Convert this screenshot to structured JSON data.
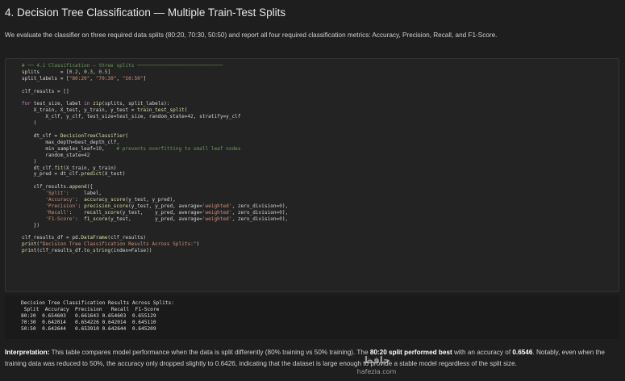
{
  "section": {
    "title": "4. Decision Tree Classification — Multiple Train-Test Splits",
    "intro": "We evaluate the classifier on three required data splits (80:20, 70:30, 50:50) and report all four required classification metrics: Accuracy, Precision, Recall, and F1-Score."
  },
  "code_lines": [
    "# ── 4.1 Classification – three splits ─────────────────────────────",
    "splits       = [0.2, 0.3, 0.5]",
    "split_labels = [\"80:20\", \"70:30\", \"50:50\"]",
    "",
    "clf_results = []",
    "",
    "for test_size, label in zip(splits, split_labels):",
    "    X_train, X_test, y_train, y_test = train_test_split(",
    "        X_clf, y_clf, test_size=test_size, random_state=42, stratify=y_clf",
    "    )",
    "",
    "    dt_clf = DecisionTreeClassifier(",
    "        max_depth=best_depth_clf,",
    "        min_samples_leaf=10,    # prevents overfitting to small leaf nodes",
    "        random_state=42",
    "    )",
    "    dt_clf.fit(X_train, y_train)",
    "    y_pred = dt_clf.predict(X_test)",
    "",
    "    clf_results.append({",
    "        'Split':     label,",
    "        'Accuracy':  accuracy_score(y_test, y_pred),",
    "        'Precision': precision_score(y_test, y_pred, average='weighted', zero_division=0),",
    "        'Recall':    recall_score(y_test,    y_pred, average='weighted', zero_division=0),",
    "        'F1-Score':  f1_score(y_test,        y_pred, average='weighted', zero_division=0),",
    "    })",
    "",
    "clf_results_df = pd.DataFrame(clf_results)",
    "print(\"Decision Tree Classification Results Across Splits:\")",
    "print(clf_results_df.to_string(index=False))"
  ],
  "output": {
    "title": "Decision Tree Classification Results Across Splits:",
    "header": " Split  Accuracy  Precision   Recall  F1-Score",
    "rows": [
      "80:20  0.654603   0.661643 0.654603  0.655129",
      "70:30  0.642014   0.654226 0.642014  0.645110",
      "50:50  0.642644   0.653910 0.642644  0.645209"
    ]
  },
  "interpretation": {
    "label": "Interpretation:",
    "text1": " This table compares model performance when the data is split differently (80% training vs 50% training). The ",
    "bold1": "80:20 split performed best",
    "text2": " with an accuracy of ",
    "bold2": "0.6546",
    "text3": ". Notably, even when the training data was reduced to 50%, the accuracy only dropped slightly to 0.6426, indicating that the dataset is large enough to provide a stable model regardless of the split size."
  },
  "watermark": {
    "text": "hafezia.com"
  }
}
